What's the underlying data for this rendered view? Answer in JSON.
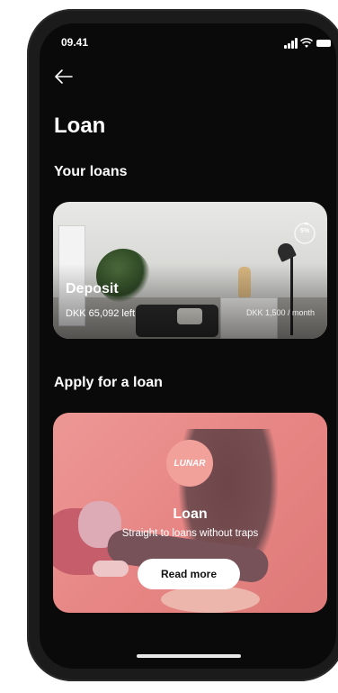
{
  "status_bar": {
    "time": "09.41"
  },
  "header": {
    "title": "Loan"
  },
  "your_loans": {
    "heading": "Your loans",
    "cards": [
      {
        "name": "Deposit",
        "left": "DKK 65,092 left",
        "monthly": "DKK 1,500 / month",
        "progress_label": "5%",
        "progress_fraction": 0.05
      }
    ]
  },
  "apply": {
    "heading": "Apply for a loan",
    "brand": "LUNAR",
    "card_title": "Loan",
    "card_subtitle": "Straight to loans without traps",
    "button_label": "Read more"
  },
  "colors": {
    "background": "#0a0a0a",
    "accent_pink": "#f2a09a"
  }
}
